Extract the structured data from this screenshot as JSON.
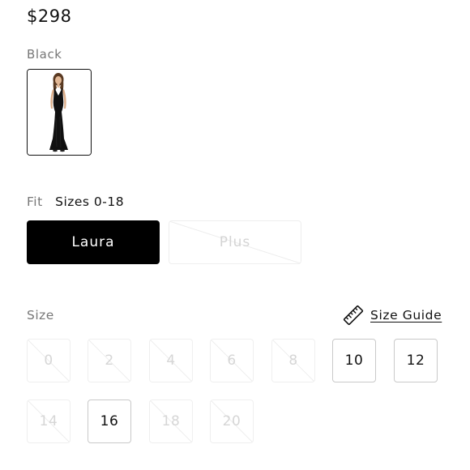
{
  "product": {
    "price": "$298",
    "color_name": "Black",
    "swatch_image": "black-gown-swatch"
  },
  "fit": {
    "label": "Fit",
    "value": "Sizes 0-18",
    "options": [
      {
        "label": "Laura",
        "state": "selected"
      },
      {
        "label": "Plus",
        "state": "unavailable"
      }
    ]
  },
  "size": {
    "label": "Size",
    "guide_label": "Size Guide",
    "guide_icon": "ruler-icon",
    "options": [
      {
        "label": "0",
        "available": false
      },
      {
        "label": "2",
        "available": false
      },
      {
        "label": "4",
        "available": false
      },
      {
        "label": "6",
        "available": false
      },
      {
        "label": "8",
        "available": false
      },
      {
        "label": "10",
        "available": true
      },
      {
        "label": "12",
        "available": true
      },
      {
        "label": "14",
        "available": false
      },
      {
        "label": "16",
        "available": true
      },
      {
        "label": "18",
        "available": false
      },
      {
        "label": "20",
        "available": false
      }
    ]
  },
  "colors": {
    "accent": "#000000",
    "muted_text": "#777777",
    "disabled_text": "#d6d6d6"
  }
}
